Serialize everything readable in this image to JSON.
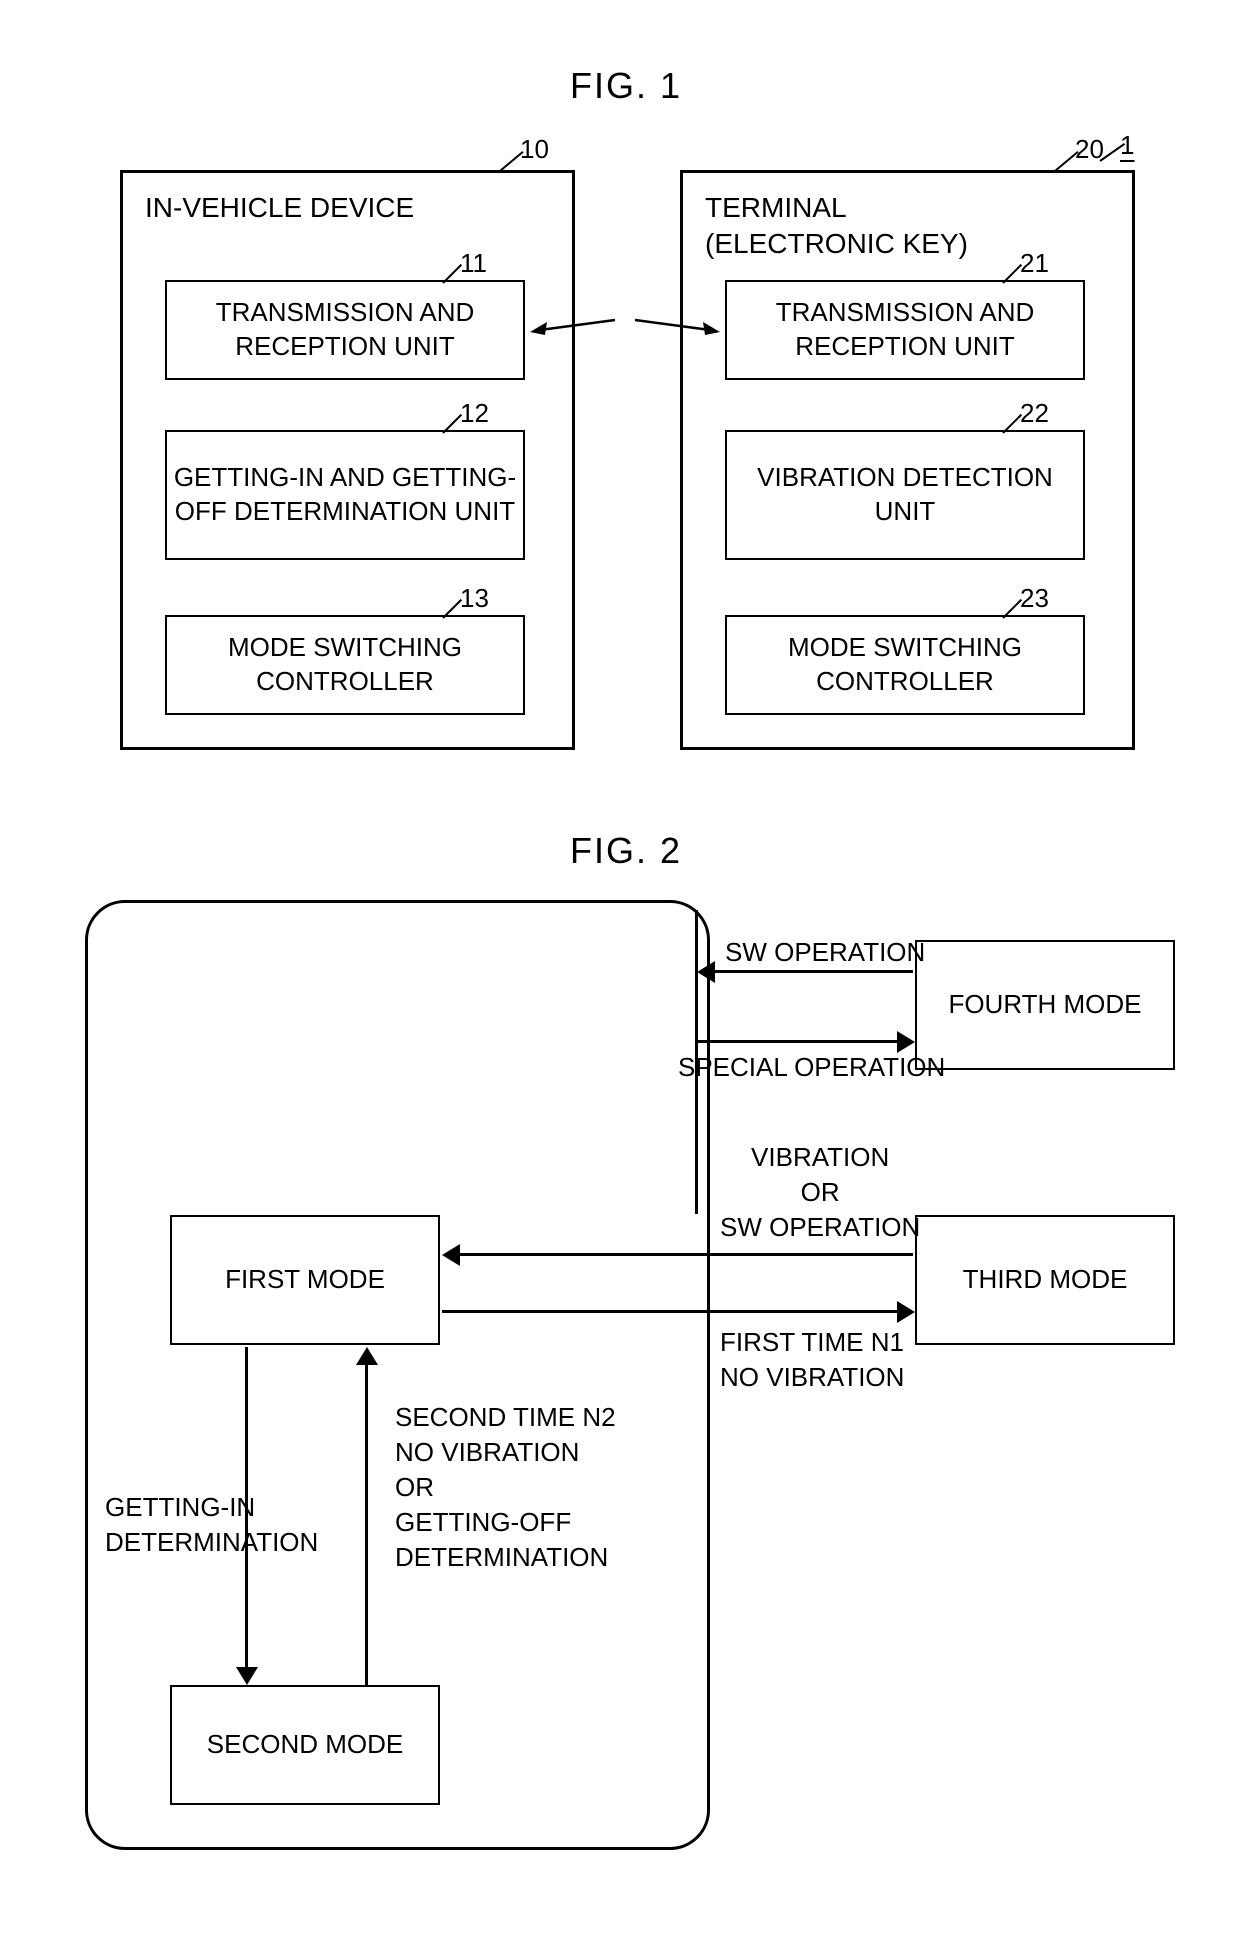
{
  "fig1": {
    "title": "FIG. 1",
    "system_ref": "1",
    "device_a": {
      "ref": "10",
      "title": "IN-VEHICLE DEVICE",
      "unit11": {
        "ref": "11",
        "label": "TRANSMISSION AND\nRECEPTION UNIT"
      },
      "unit12": {
        "ref": "12",
        "label": "GETTING-IN AND\nGETTING-OFF\nDETERMINATION UNIT"
      },
      "unit13": {
        "ref": "13",
        "label": "MODE SWITCHING\nCONTROLLER"
      }
    },
    "device_b": {
      "ref": "20",
      "title": "TERMINAL\n(ELECTRONIC KEY)",
      "unit21": {
        "ref": "21",
        "label": "TRANSMISSION AND\nRECEPTION UNIT"
      },
      "unit22": {
        "ref": "22",
        "label": "VIBRATION\nDETECTION UNIT"
      },
      "unit23": {
        "ref": "23",
        "label": "MODE SWITCHING\nCONTROLLER"
      }
    }
  },
  "fig2": {
    "title": "FIG. 2",
    "modes": {
      "first": "FIRST MODE",
      "second": "SECOND MODE",
      "third": "THIRD MODE",
      "fourth": "FOURTH MODE"
    },
    "edges": {
      "sw_operation": "SW OPERATION",
      "special_operation": "SPECIAL OPERATION",
      "vibration_or_sw": "VIBRATION\nOR\nSW OPERATION",
      "first_time": "FIRST TIME N1\nNO VIBRATION",
      "getting_in": "GETTING-IN\nDETERMINATION",
      "second_time": "SECOND TIME N2\nNO VIBRATION\nOR\nGETTING-OFF\nDETERMINATION"
    }
  }
}
